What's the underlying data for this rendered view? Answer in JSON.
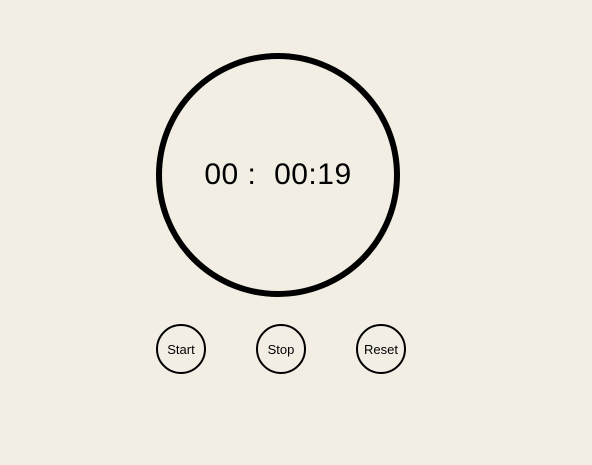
{
  "theme": {
    "background": "#f2eee4",
    "ring": "#000000",
    "text": "#000000"
  },
  "timer": {
    "minutes": "00",
    "separator": " :  ",
    "seconds": "00:19"
  },
  "controls": {
    "start_label": "Start",
    "stop_label": "Stop",
    "reset_label": "Reset"
  }
}
